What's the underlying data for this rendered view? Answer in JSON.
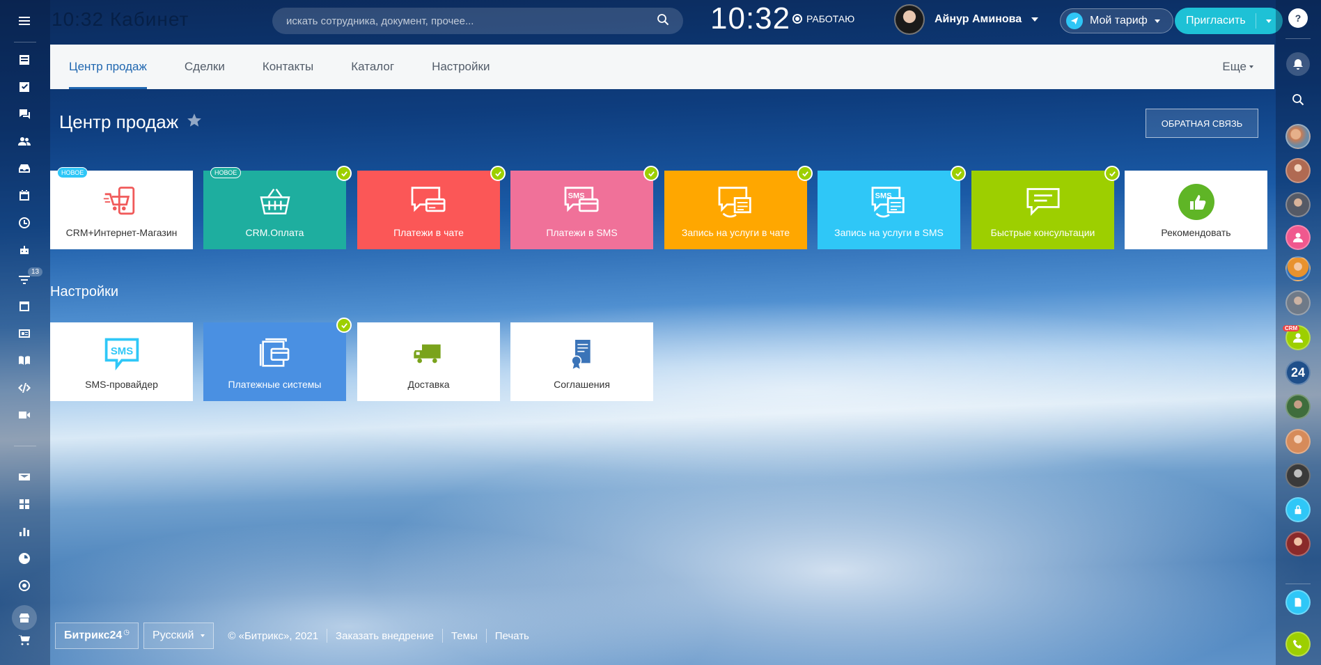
{
  "header": {
    "ghost_title": "10:32  Кабинет",
    "search_placeholder": "искать сотрудника, документ, прочее...",
    "clock": "10:32",
    "status": "РАБОТАЮ",
    "user_name": "Айнур Аминова",
    "tariff_label": "Мой тариф",
    "invite_label": "Пригласить"
  },
  "left_sidebar": {
    "badge_count": "13",
    "icons": [
      "menu-icon",
      "news-icon",
      "tasks-icon",
      "chat-icon",
      "groups-icon",
      "inbox-icon",
      "calendar-icon",
      "clock-icon",
      "robot-icon",
      "funnel-icon",
      "window-icon",
      "contact-card-icon",
      "book-icon",
      "code-icon",
      "video-icon",
      "mail-icon",
      "apps-icon",
      "chart-icon",
      "pie-icon",
      "target-icon",
      "shop-icon",
      "cart-icon"
    ]
  },
  "tabs": {
    "items": [
      {
        "label": "Центр продаж"
      },
      {
        "label": "Сделки"
      },
      {
        "label": "Контакты"
      },
      {
        "label": "Каталог"
      },
      {
        "label": "Настройки"
      }
    ],
    "more_label": "Еще"
  },
  "page": {
    "title": "Центр продаж",
    "feedback_label": "ОБРАТНАЯ СВЯЗЬ",
    "settings_title": "Настройки"
  },
  "tiles_main": [
    {
      "label": "CRM+Интернет-Магазин",
      "badge": "НОВОЕ",
      "color": "#ffffff"
    },
    {
      "label": "CRM.Оплата",
      "badge": "НОВОЕ",
      "color": "#1eae9f"
    },
    {
      "label": "Платежи в чате",
      "color": "#fb5757"
    },
    {
      "label": "Платежи в SMS",
      "color": "#f07199"
    },
    {
      "label": "Запись на услуги в чате",
      "color": "#ffa700"
    },
    {
      "label": "Запись на услуги в SMS",
      "color": "#2fc7f7"
    },
    {
      "label": "Быстрые консультации",
      "color": "#9dcf00"
    },
    {
      "label": "Рекомендовать",
      "color": "#ffffff"
    }
  ],
  "tiles_settings": [
    {
      "label": "SMS-провайдер",
      "color": "#ffffff"
    },
    {
      "label": "Платежные системы",
      "color": "#4a90e2"
    },
    {
      "label": "Доставка",
      "color": "#ffffff"
    },
    {
      "label": "Соглашения",
      "color": "#ffffff"
    }
  ],
  "right_bar": {
    "crm_badge": "CRM",
    "b24_label": "24"
  },
  "footer": {
    "logo": "Битрикс24",
    "language": "Русский",
    "copyright": "© «Битрикс», 2021",
    "order_link": "Заказать внедрение",
    "themes_link": "Темы",
    "print_link": "Печать"
  }
}
